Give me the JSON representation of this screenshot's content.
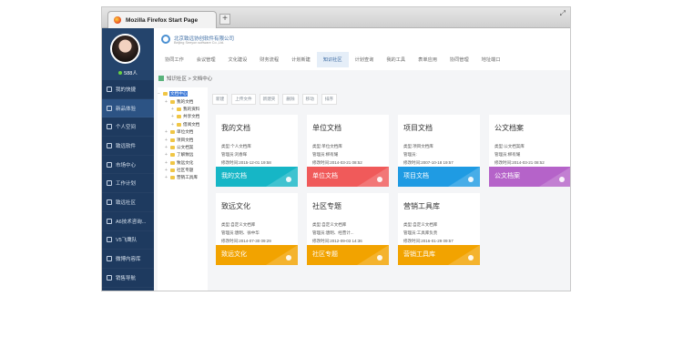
{
  "browser": {
    "tab_title": "Mozilla Firefox Start Page",
    "new_tab": "+",
    "window_controls": "⤢"
  },
  "user": {
    "name": "588人"
  },
  "sidebar": {
    "items": [
      {
        "label": "我的快捷",
        "active": false
      },
      {
        "label": "新品体验",
        "active": true
      },
      {
        "label": "个人空间",
        "active": false
      },
      {
        "label": "致远软件",
        "active": false
      },
      {
        "label": "市场中心",
        "active": false
      },
      {
        "label": "工作计划",
        "active": false
      },
      {
        "label": "致远社区",
        "active": false
      },
      {
        "label": "A6技术咨询...",
        "active": false
      },
      {
        "label": "V5飞鹰队",
        "active": false
      },
      {
        "label": "微博内容库",
        "active": false
      },
      {
        "label": "销售导航",
        "active": false
      }
    ]
  },
  "header": {
    "brand": "北京致远协创软件有限公司",
    "brand_sub": "Beijing Seeyon software Co.,Ltd.",
    "nav": [
      {
        "label": "协同工作",
        "active": false
      },
      {
        "label": "会议管理",
        "active": false
      },
      {
        "label": "文化建设",
        "active": false
      },
      {
        "label": "财务流程",
        "active": false
      },
      {
        "label": "计划新建",
        "active": false
      },
      {
        "label": "知识社区",
        "active": true
      },
      {
        "label": "计划查询",
        "active": false
      },
      {
        "label": "我的工具",
        "active": false
      },
      {
        "label": "表单应用",
        "active": false
      },
      {
        "label": "协同管理",
        "active": false
      },
      {
        "label": "地址端口",
        "active": false
      }
    ]
  },
  "breadcrumb": "知识社区 > 文档中心",
  "toolbar": [
    "新建",
    "上传文件",
    "新建夹",
    "删除",
    "移动",
    "排序"
  ],
  "tree": [
    {
      "label": "文档中心",
      "indent": 0,
      "selected": true
    },
    {
      "label": "我的文档",
      "indent": 1,
      "selected": false
    },
    {
      "label": "我的资料",
      "indent": 2,
      "selected": false
    },
    {
      "label": "共享文档",
      "indent": 2,
      "selected": false
    },
    {
      "label": "借阅文档",
      "indent": 2,
      "selected": false
    },
    {
      "label": "单位文档",
      "indent": 1,
      "selected": false
    },
    {
      "label": "项目文档",
      "indent": 1,
      "selected": false
    },
    {
      "label": "公文档案",
      "indent": 1,
      "selected": false
    },
    {
      "label": "了解致远",
      "indent": 1,
      "selected": false
    },
    {
      "label": "致远文化",
      "indent": 1,
      "selected": false
    },
    {
      "label": "社区专题",
      "indent": 1,
      "selected": false
    },
    {
      "label": "营销工具库",
      "indent": 1,
      "selected": false
    }
  ],
  "cards": [
    {
      "title": "我的文档",
      "type": "类型:个人文档库",
      "manager": "管理员:刘春晖",
      "modified": "修改时间:2015-12-01 19:58",
      "label": "我的文档",
      "color": "#16b6c6"
    },
    {
      "title": "单位文档",
      "type": "类型:单位文档库",
      "manager": "管理员:柳有耀",
      "modified": "修改时间:2014-03-21 08:52",
      "label": "单位文档",
      "color": "#f05a5a"
    },
    {
      "title": "项目文档",
      "type": "类型:项目文档库",
      "manager": "管理员:",
      "modified": "修改时间:2007-10-18 19:57",
      "label": "项目文档",
      "color": "#1f9be3"
    },
    {
      "title": "公文档案",
      "type": "类型:公文档案库",
      "manager": "管理员:柳有耀",
      "modified": "修改时间:2014-03-21 08:52",
      "label": "公文档案",
      "color": "#b563c9"
    },
    {
      "title": "致远文化",
      "type": "类型:自定义文档库",
      "manager": "管理员:唐明、徐中华",
      "modified": "修改时间:2014-07-30 09:29",
      "label": "致远文化",
      "color": "#f2a300"
    },
    {
      "title": "社区专题",
      "type": "类型:自定义文档库",
      "manager": "管理员:唐明、经营计...",
      "modified": "修改时间:2012-09-03 14:36",
      "label": "社区专题",
      "color": "#f2a300"
    },
    {
      "title": "营销工具库",
      "type": "类型:自定义文档库",
      "manager": "管理员:工具库负责",
      "modified": "修改时间:2016-01-29 09:57",
      "label": "营销工具库",
      "color": "#f2a300"
    }
  ]
}
